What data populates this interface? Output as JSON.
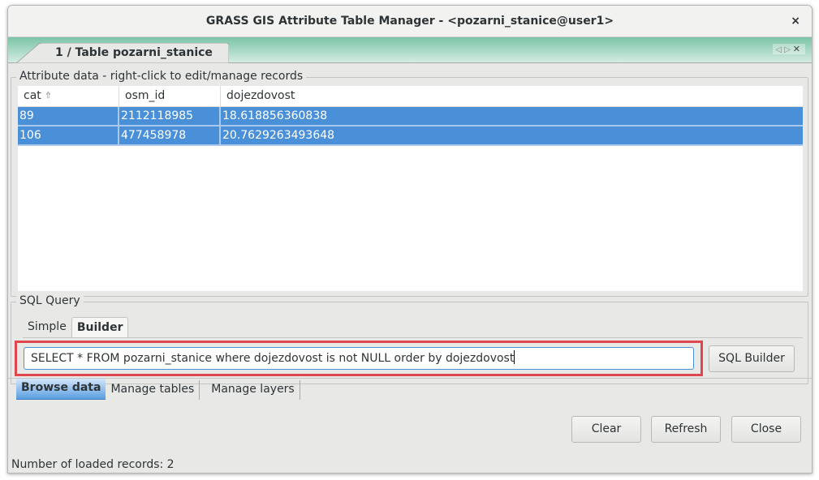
{
  "window": {
    "title": "GRASS GIS Attribute Table Manager - <pozarni_stanice@user1>",
    "close_icon": "close-icon"
  },
  "notebook": {
    "tab_label": "1 / Table pozarni_stanice",
    "controls": {
      "prev": "◁",
      "next": "▷",
      "close": "✕"
    }
  },
  "attribute_data": {
    "legend": "Attribute data - right-click to edit/manage records",
    "columns": [
      {
        "label": "cat",
        "sort_icon": "sort-ascending-icon"
      },
      {
        "label": "osm_id"
      },
      {
        "label": "dojezdovost"
      }
    ],
    "rows": [
      {
        "cat": "89",
        "osm_id": "2112118985",
        "dojezdovost": "18.618856360838",
        "selected": true
      },
      {
        "cat": "106",
        "osm_id": "477458978",
        "dojezdovost": "20.7629263493648",
        "selected": true
      }
    ]
  },
  "sql_query": {
    "legend": "SQL Query",
    "tabs": [
      {
        "label": "Simple",
        "active": false
      },
      {
        "label": "Builder",
        "active": true
      }
    ],
    "query_value": "SELECT * FROM pozarni_stanice where dojezdovost is not NULL order by dojezdovost",
    "sql_builder_label": "SQL Builder"
  },
  "main_tabs": [
    {
      "label": "Browse data",
      "active": true
    },
    {
      "label": "Manage tables",
      "active": false
    },
    {
      "label": "Manage layers",
      "active": false
    }
  ],
  "buttons": {
    "clear": "Clear",
    "refresh": "Refresh",
    "close": "Close"
  },
  "status": "Number of loaded records: 2",
  "colors": {
    "selection": "#4a90d9",
    "highlight_border": "#e0474c",
    "tabbar_top": "#7cc4a8",
    "tabbar_bottom": "#d4ece2"
  }
}
